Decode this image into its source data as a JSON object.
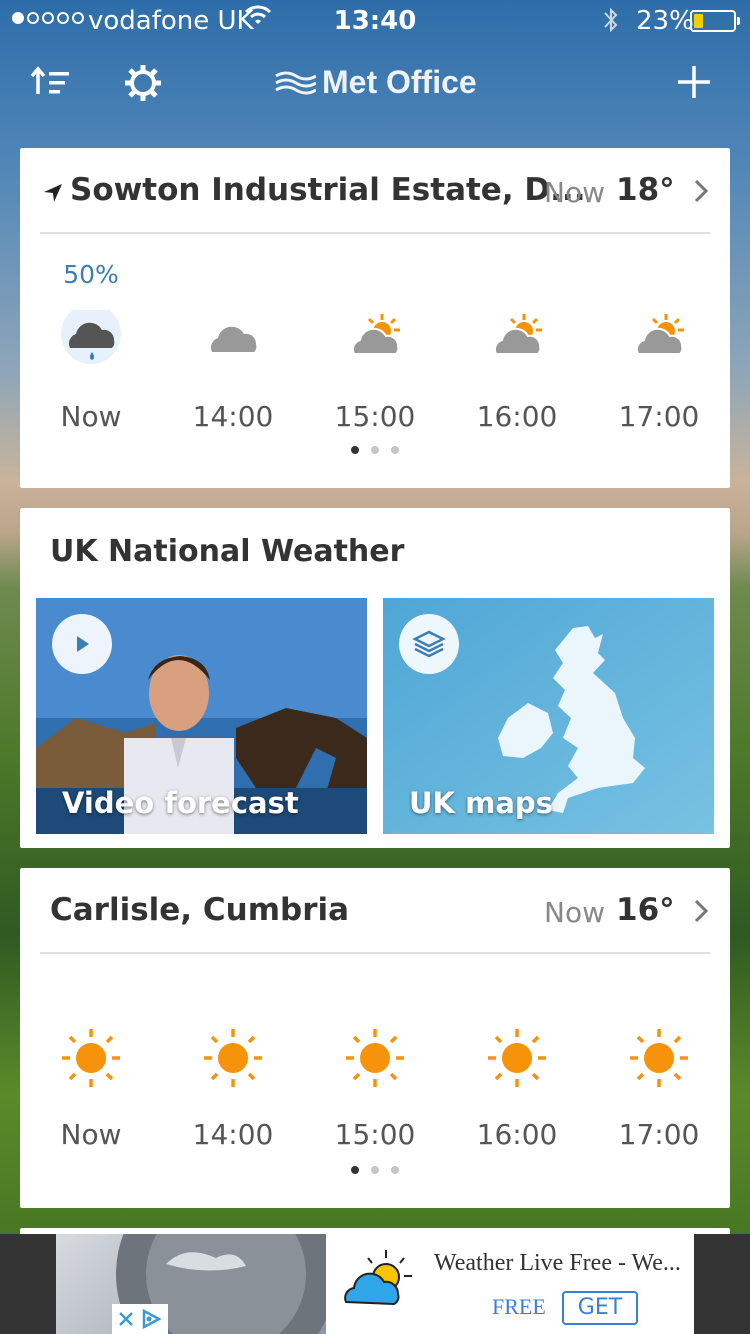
{
  "status_bar": {
    "carrier": "vodafone UK",
    "time": "13:40",
    "battery_pct": "23%",
    "signal_bars_filled": 1,
    "signal_bars_total": 5
  },
  "nav": {
    "logo_text": "Met Office",
    "sort_icon": "sort-icon",
    "settings_icon": "gear-icon",
    "add_icon": "plus-icon"
  },
  "location_card_1": {
    "name": "Sowton Industrial Estate, D...",
    "now_label": "Now",
    "temp": "18°",
    "precip": "50%",
    "hours": [
      {
        "time": "Now",
        "icon": "cloud-rain-icon"
      },
      {
        "time": "14:00",
        "icon": "cloud-icon"
      },
      {
        "time": "15:00",
        "icon": "sun-cloud-icon"
      },
      {
        "time": "16:00",
        "icon": "sun-cloud-icon"
      },
      {
        "time": "17:00",
        "icon": "sun-cloud-icon"
      }
    ]
  },
  "national": {
    "title": "UK National Weather",
    "video_label": "Video forecast",
    "maps_label": "UK maps"
  },
  "location_card_2": {
    "name": "Carlisle, Cumbria",
    "now_label": "Now",
    "temp": "16°",
    "hours": [
      {
        "time": "Now",
        "icon": "sun-icon"
      },
      {
        "time": "14:00",
        "icon": "sun-icon"
      },
      {
        "time": "15:00",
        "icon": "sun-icon"
      },
      {
        "time": "16:00",
        "icon": "sun-icon"
      },
      {
        "time": "17:00",
        "icon": "sun-icon"
      }
    ]
  },
  "ad": {
    "title": "Weather Live Free - We...",
    "free_label": "FREE",
    "get_label": "GET"
  },
  "colors": {
    "sun": "#f7930a",
    "cloud": "#9b9b9b",
    "dark_cloud": "#555555",
    "accent_blue": "#3a7fb0"
  }
}
